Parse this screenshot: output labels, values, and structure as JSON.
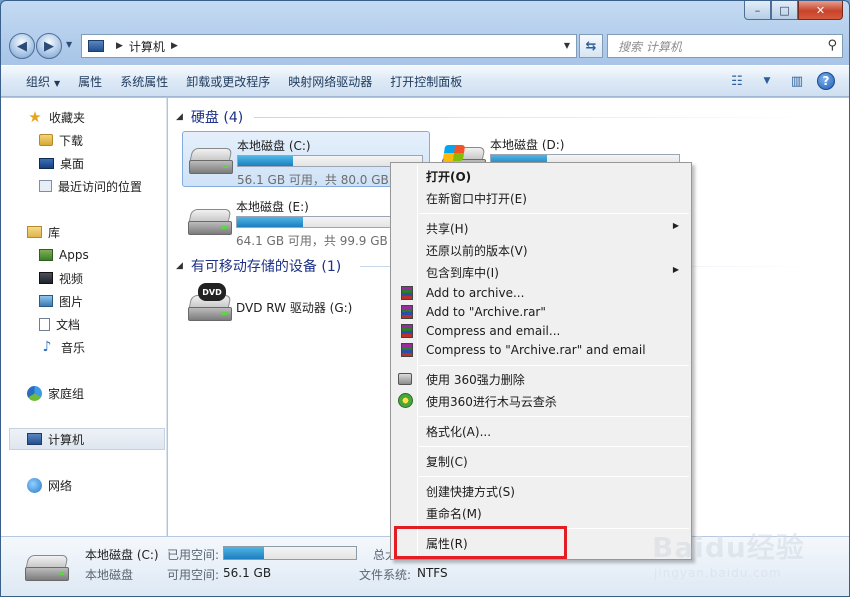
{
  "window": {
    "caption": {
      "min": "–",
      "max": "□",
      "close": "✕"
    }
  },
  "nav": {
    "address_path": "计算机",
    "search_placeholder": "搜索 计算机"
  },
  "toolbar": {
    "items": [
      "组织",
      "属性",
      "系统属性",
      "卸载或更改程序",
      "映射网络驱动器",
      "打开控制面板"
    ]
  },
  "sidebar": {
    "favorites": {
      "label": "收藏夹",
      "items": [
        "下载",
        "桌面",
        "最近访问的位置"
      ]
    },
    "libraries": {
      "label": "库",
      "items": [
        "Apps",
        "视频",
        "图片",
        "文档",
        "音乐"
      ]
    },
    "homegroup": "家庭组",
    "computer": "计算机",
    "network": "网络"
  },
  "content": {
    "hard_drives": {
      "header": "硬盘 (4)",
      "drives": [
        {
          "name": "本地磁盘 (C:)",
          "size": "56.1 GB 可用，共 80.0 GB",
          "used_fraction": 0.3
        },
        {
          "name": "本地磁盘 (D:)",
          "size": "",
          "used_fraction": 0.3
        },
        {
          "name": "本地磁盘 (E:)",
          "size": "64.1 GB 可用，共 99.9 GB",
          "used_fraction": 0.36
        }
      ]
    },
    "removable": {
      "header": "有可移动存储的设备 (1)",
      "drives": [
        {
          "name": "DVD RW 驱动器 (G:)",
          "badge": "DVD"
        }
      ]
    }
  },
  "context_menu": {
    "items": [
      "打开(O)",
      "在新窗口中打开(E)",
      "共享(H)",
      "还原以前的版本(V)",
      "包含到库中(I)",
      "Add to archive...",
      "Add to \"Archive.rar\"",
      "Compress and email...",
      "Compress to \"Archive.rar\" and email",
      "使用 360强力删除",
      "使用360进行木马云查杀",
      "格式化(A)...",
      "复制(C)",
      "创建快捷方式(S)",
      "重命名(M)",
      "属性(R)"
    ]
  },
  "details": {
    "name": "本地磁盘 (C:)",
    "type": "本地磁盘",
    "used_label": "已用空间:",
    "free_label": "可用空间:",
    "free_value": "56.1 GB",
    "total_label": "总大",
    "fs_label": "文件系统:",
    "fs_value": "NTFS",
    "used_fraction": 0.3
  },
  "watermark": {
    "main": "Baidu经验",
    "sub": "jingyan.baidu.com"
  },
  "colors": {
    "accent": "#1e3287",
    "highlight": "#e21d23"
  }
}
